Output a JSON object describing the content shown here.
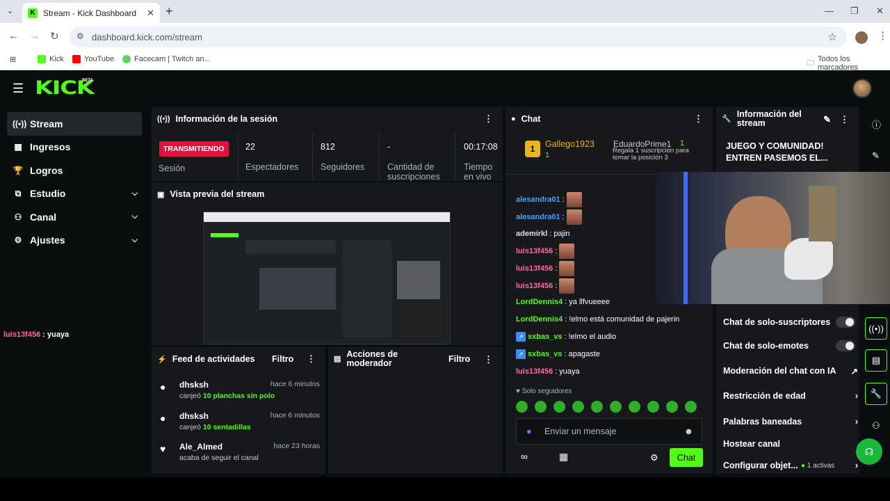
{
  "browser": {
    "tab_title": "Stream - Kick Dashboard",
    "url": "dashboard.kick.com/stream",
    "bookmarks": [
      "Kick",
      "YouTube",
      "Facecam | Twitch an..."
    ],
    "all_bookmarks": "Todos los marcadores"
  },
  "app": {
    "logo": "KICK",
    "beta": "BETA",
    "accent": "#53fc18"
  },
  "sidebar": {
    "items": [
      {
        "label": "Stream",
        "icon": "broadcast-icon"
      },
      {
        "label": "Ingresos",
        "icon": "chart-icon"
      },
      {
        "label": "Logros",
        "icon": "trophy-icon"
      },
      {
        "label": "Estudio",
        "icon": "studio-icon"
      },
      {
        "label": "Canal",
        "icon": "users-icon"
      },
      {
        "label": "Ajustes",
        "icon": "gear-icon"
      }
    ],
    "chat_user": "luis13f456",
    "chat_msg": " : yuaya"
  },
  "session": {
    "title": "Información de la sesión",
    "status": "TRANSMITIENDO",
    "status_label": "Sesión",
    "viewers": "22",
    "viewers_label": "Espectadores",
    "followers": "812",
    "followers_label": "Seguidores",
    "subs": "-",
    "subs_label": "Cantidad de suscripciones",
    "time": "00:17:08",
    "time_label": "Tiempo en vivo"
  },
  "preview": {
    "title": "Vista previa del stream"
  },
  "feed": {
    "title": "Feed de actividades",
    "filter": "Filtro",
    "items": [
      {
        "name": "dhsksh",
        "time": "hace 6 minutos",
        "pre": "canjeó ",
        "hl": "10 planchas sin polo"
      },
      {
        "name": "dhsksh",
        "time": "hace 6 minutos",
        "pre": "canjeó ",
        "hl": "10 sentadillas"
      },
      {
        "name": "Ale_Almed",
        "time": "hace 23 horas",
        "pre": "acaba de seguir el canal",
        "hl": ""
      }
    ]
  },
  "mod": {
    "title": "Acciones de moderador",
    "filter": "Filtro"
  },
  "chat": {
    "title": "Chat",
    "top1": {
      "name": "Gallego1923",
      "count": "1"
    },
    "top2": {
      "name": "EduardoPrime1",
      "count": "1"
    },
    "gift_text": "Regala 1 suscripción para tomar la posición 3",
    "lines": [
      {
        "user": "alesandra01",
        "color": "#4aa3ff",
        "text": ""
      },
      {
        "user": "alesandra01",
        "color": "#4aa3ff",
        "text": ""
      },
      {
        "user": "ademirkl",
        "color": "#e0e0e0",
        "text": " pajin"
      },
      {
        "user": "luis13f456",
        "color": "#ff6b9a",
        "text": ""
      },
      {
        "user": "luis13f456",
        "color": "#ff6b9a",
        "text": ""
      },
      {
        "user": "luis13f456",
        "color": "#ff6b9a",
        "text": ""
      },
      {
        "user": "LordDennis4",
        "color": "#53fc18",
        "text": " ya llfvueeee"
      },
      {
        "user": "LordDennis4",
        "color": "#53fc18",
        "text": " !elmo está comunidad de pajerin"
      },
      {
        "user": "sxbas_vs",
        "color": "#53fc18",
        "text": " !elmo el audio"
      },
      {
        "user": "sxbas_vs",
        "color": "#53fc18",
        "text": " apagaste"
      },
      {
        "user": "luis13f456",
        "color": "#ff6b9a",
        "text": " yuaya"
      }
    ],
    "mode": "Solo seguidores",
    "placeholder": "Enviar un mensaje",
    "send": "Chat"
  },
  "info": {
    "title": "Información del stream",
    "stream_title": "JUEGO Y COMUNIDAD! ENTREN PASEMOS EL...",
    "settings": [
      {
        "label": "Chat de solo-suscriptores"
      },
      {
        "label": "Chat de solo-emotes"
      },
      {
        "label": "Moderación del chat con IA"
      },
      {
        "label": "Restricción de edad"
      },
      {
        "label": "Palabras baneadas"
      },
      {
        "label": "Hostear canal"
      },
      {
        "label": "Configurar objet..."
      }
    ],
    "active": "1 activas"
  }
}
